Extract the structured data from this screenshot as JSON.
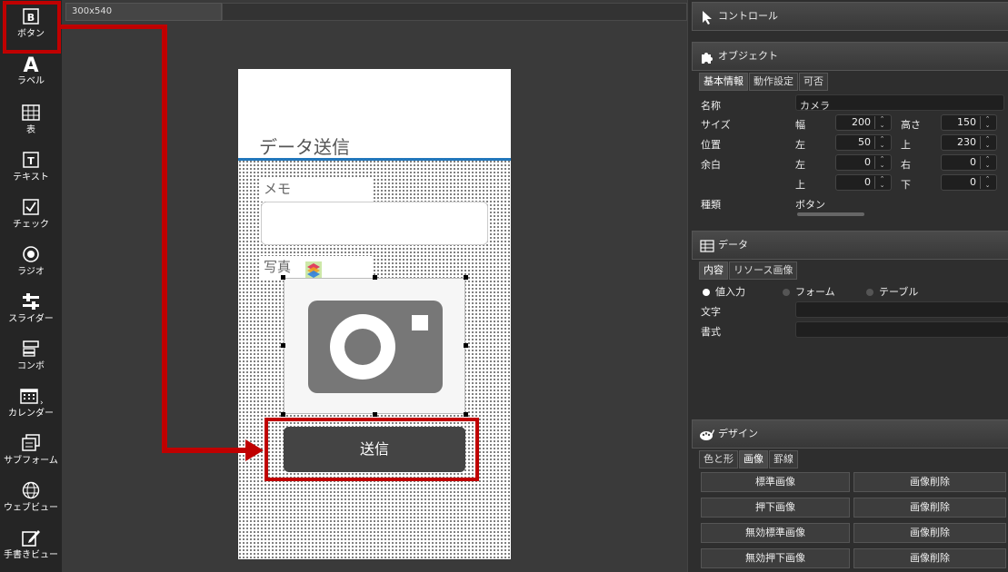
{
  "toolbox": {
    "items": [
      {
        "label": "ボタン",
        "icon": "button-icon"
      },
      {
        "label": "ラベル",
        "icon": "label-icon"
      },
      {
        "label": "表",
        "icon": "table-icon"
      },
      {
        "label": "テキスト",
        "icon": "text-icon"
      },
      {
        "label": "チェック",
        "icon": "check-icon"
      },
      {
        "label": "ラジオ",
        "icon": "radio-icon"
      },
      {
        "label": "スライダー",
        "icon": "slider-icon"
      },
      {
        "label": "コンボ",
        "icon": "combo-icon"
      },
      {
        "label": "カレンダー",
        "icon": "calendar-icon"
      },
      {
        "label": "サブフォーム",
        "icon": "subform-icon"
      },
      {
        "label": "ウェブビュー",
        "icon": "webview-icon"
      },
      {
        "label": "手書きビュー",
        "icon": "handwriting-icon"
      }
    ]
  },
  "design": {
    "tab_label": "300x540",
    "form_title": "データ送信",
    "memo_label": "メモ",
    "photo_label": "写真",
    "send_label": "送信"
  },
  "control_panel": {
    "title": "コントロール"
  },
  "object_panel": {
    "title": "オブジェクト",
    "tabs": [
      "基本情報",
      "動作設定",
      "可否"
    ],
    "name_label": "名称",
    "name_value": "カメラ",
    "size_label": "サイズ",
    "width_label": "幅",
    "width_value": "200",
    "height_label": "高さ",
    "height_value": "150",
    "pos_label": "位置",
    "left_label": "左",
    "left_value": "50",
    "top_label": "上",
    "top_value": "230",
    "margin_label": "余白",
    "m_left_label": "左",
    "m_left_value": "0",
    "m_right_label": "右",
    "m_right_value": "0",
    "m_top_label": "上",
    "m_top_value": "0",
    "m_bottom_label": "下",
    "m_bottom_value": "0",
    "type_label": "種類",
    "type_value": "ボタン"
  },
  "data_panel": {
    "title": "データ",
    "tabs": [
      "内容",
      "リソース画像"
    ],
    "radios": [
      "値入力",
      "フォーム",
      "テーブル"
    ],
    "text_label": "文字",
    "format_label": "書式"
  },
  "design_panel": {
    "title": "デザイン",
    "tabs": [
      "色と形",
      "画像",
      "罫線"
    ],
    "rows": [
      {
        "left": "標準画像",
        "right": "画像削除"
      },
      {
        "left": "押下画像",
        "right": "画像削除"
      },
      {
        "left": "無効標準画像",
        "right": "画像削除"
      },
      {
        "left": "無効押下画像",
        "right": "画像削除"
      }
    ]
  },
  "colors": {
    "accent_red": "#c00000",
    "title_line": "#2277bb"
  }
}
